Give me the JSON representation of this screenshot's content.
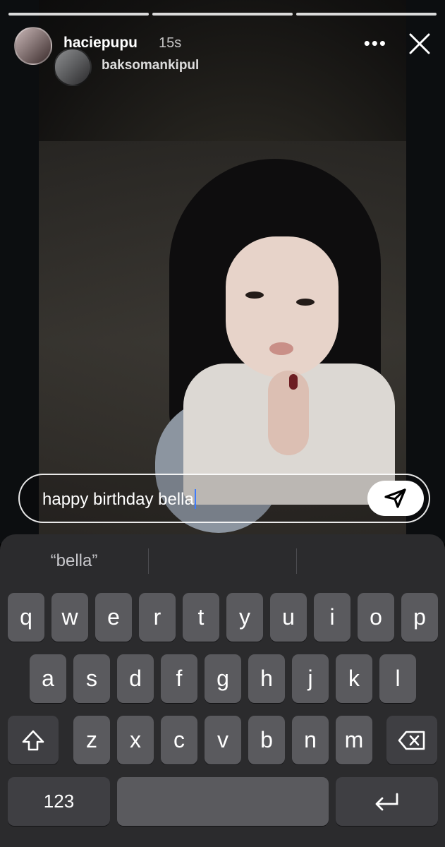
{
  "story": {
    "username": "haciepupu",
    "time": "15s",
    "reposted_from": "baksomankipul",
    "more_label": "•••",
    "progress_segments": 3
  },
  "reply": {
    "text": "happy birthday bella"
  },
  "keyboard": {
    "suggestions": [
      "“bella”",
      "",
      ""
    ],
    "row1": [
      "q",
      "w",
      "e",
      "r",
      "t",
      "y",
      "u",
      "i",
      "o",
      "p"
    ],
    "row2": [
      "a",
      "s",
      "d",
      "f",
      "g",
      "h",
      "j",
      "k",
      "l"
    ],
    "row3": [
      "z",
      "x",
      "c",
      "v",
      "b",
      "n",
      "m"
    ],
    "numbers_label": "123"
  },
  "icons": {
    "close": "close-icon",
    "send": "send-icon",
    "shift": "shift-icon",
    "backspace": "backspace-icon",
    "return": "return-icon"
  }
}
